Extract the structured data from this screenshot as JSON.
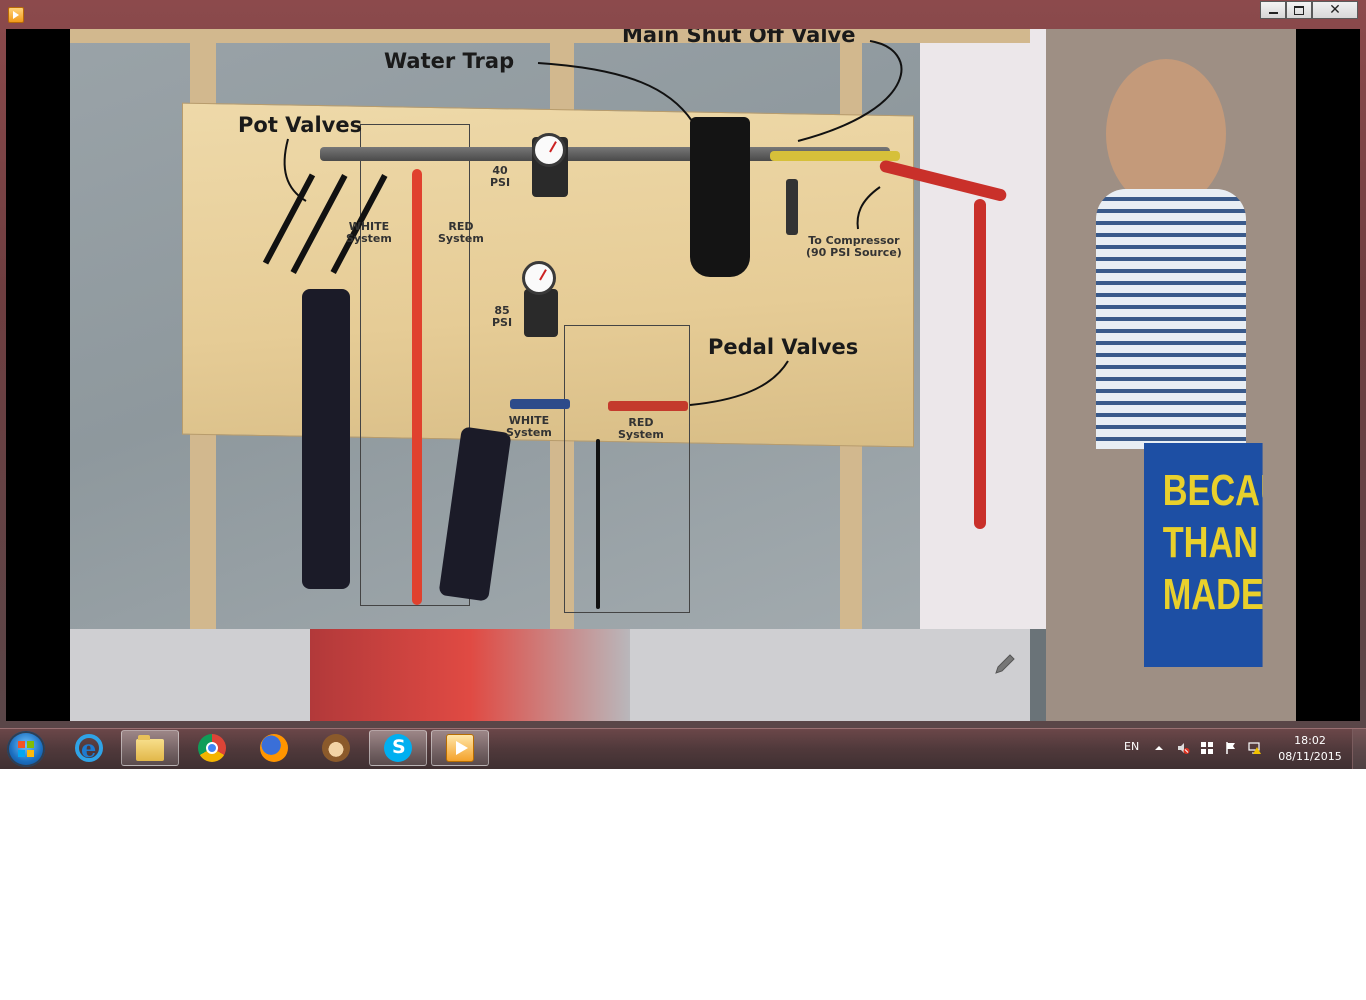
{
  "window": {
    "title": "",
    "controls": {
      "minimize": "minimize",
      "maximize": "maximize",
      "close": "✕"
    }
  },
  "photo": {
    "labels": {
      "main_shut_off_valve": "Main Shut Off Valve",
      "water_trap": "Water Trap",
      "pot_valves": "Pot Valves",
      "pedal_valves": "Pedal Valves",
      "psi_40": "40\nPSI",
      "psi_85": "85\nPSI",
      "white_system_top": "WHITE\nSystem",
      "red_system_top": "RED\nSystem",
      "white_system_bottom": "WHITE\nSystem",
      "red_system_bottom": "RED\nSystem",
      "to_compressor": "To Compressor\n(90 PSI Source)"
    },
    "banner_text": "BECAUSE\nTHAN HIG\nMADE CO"
  },
  "taskbar": {
    "pinned": [
      {
        "name": "internet-explorer",
        "icon": "ie-icon"
      },
      {
        "name": "file-explorer",
        "icon": "folder-icon"
      },
      {
        "name": "google-chrome",
        "icon": "chrome-icon"
      },
      {
        "name": "firefox",
        "icon": "firefox-icon"
      },
      {
        "name": "monkey-app",
        "icon": "monkey-icon"
      },
      {
        "name": "skype",
        "icon": "skype-icon"
      },
      {
        "name": "media-player",
        "icon": "media-player-icon"
      }
    ],
    "language": "EN",
    "time": "18:02",
    "date": "08/11/2015"
  },
  "colors": {
    "window_frame": "#6e3e40",
    "taskbar": "#50393b",
    "banner_blue": "#1d4fa4",
    "banner_yellow": "#e9d02c",
    "hose_red": "#e0412e"
  }
}
